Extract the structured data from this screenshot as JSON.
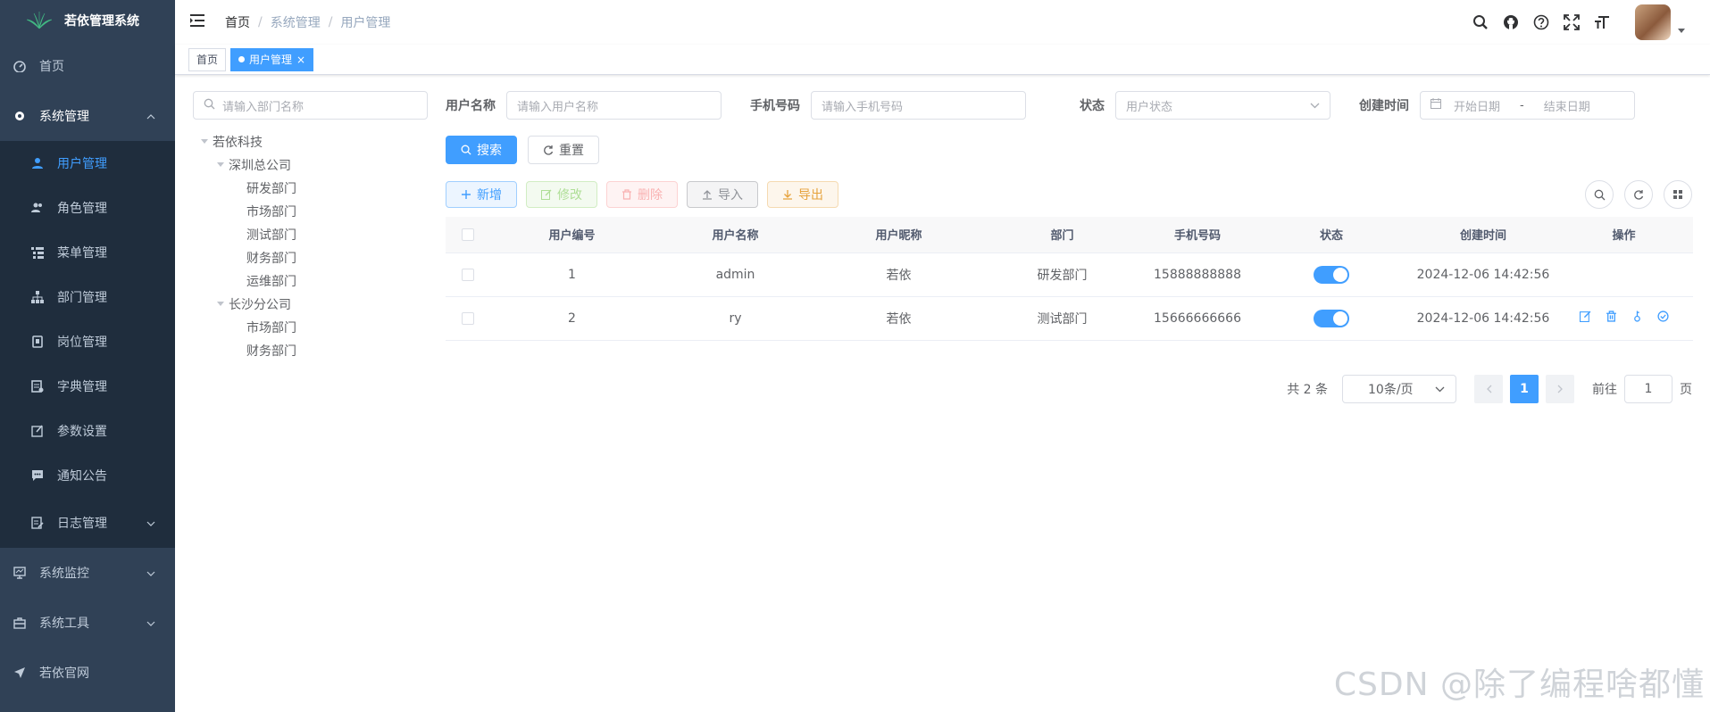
{
  "app": {
    "title": "若依管理系统"
  },
  "sidebar": {
    "items": [
      {
        "label": "首页"
      },
      {
        "label": "系统管理"
      },
      {
        "label": "系统监控"
      },
      {
        "label": "系统工具"
      },
      {
        "label": "若依官网"
      }
    ],
    "sub_items": [
      {
        "label": "用户管理"
      },
      {
        "label": "角色管理"
      },
      {
        "label": "菜单管理"
      },
      {
        "label": "部门管理"
      },
      {
        "label": "岗位管理"
      },
      {
        "label": "字典管理"
      },
      {
        "label": "参数设置"
      },
      {
        "label": "通知公告"
      },
      {
        "label": "日志管理"
      }
    ],
    "active_color": "#409eff",
    "bg_color": "#304156"
  },
  "breadcrumb": {
    "items": [
      "首页",
      "系统管理",
      "用户管理"
    ],
    "sep": "/"
  },
  "tags": [
    {
      "label": "首页"
    },
    {
      "label": "用户管理"
    }
  ],
  "dept_search": {
    "placeholder": "请输入部门名称"
  },
  "tree": {
    "root": "若依科技",
    "branches": [
      {
        "label": "深圳总公司",
        "children": [
          "研发部门",
          "市场部门",
          "测试部门",
          "财务部门",
          "运维部门"
        ]
      },
      {
        "label": "长沙分公司",
        "children": [
          "市场部门",
          "财务部门"
        ]
      }
    ]
  },
  "search_form": {
    "username_label": "用户名称",
    "username_placeholder": "请输入用户名称",
    "phone_label": "手机号码",
    "phone_placeholder": "请输入手机号码",
    "status_label": "状态",
    "status_placeholder": "用户状态",
    "created_label": "创建时间",
    "start_placeholder": "开始日期",
    "range_sep": "-",
    "end_placeholder": "结束日期",
    "search_btn": "搜索",
    "reset_btn": "重置"
  },
  "toolbar": {
    "add": "新增",
    "edit": "修改",
    "delete": "删除",
    "import": "导入",
    "export": "导出"
  },
  "table": {
    "columns": [
      "用户编号",
      "用户名称",
      "用户昵称",
      "部门",
      "手机号码",
      "状态",
      "创建时间",
      "操作"
    ],
    "rows": [
      {
        "id": "1",
        "username": "admin",
        "nickname": "若依",
        "dept": "研发部门",
        "phone": "15888888888",
        "status": true,
        "created": "2024-12-06 14:42:56"
      },
      {
        "id": "2",
        "username": "ry",
        "nickname": "若依",
        "dept": "测试部门",
        "phone": "15666666666",
        "status": true,
        "created": "2024-12-06 14:42:56"
      }
    ]
  },
  "pagination": {
    "total_text": "共 2 条",
    "page_size": "10条/页",
    "current_page": "1",
    "goto_label": "前往",
    "goto_value": "1",
    "page_suffix": "页"
  },
  "watermark": "CSDN @除了编程啥都懂"
}
